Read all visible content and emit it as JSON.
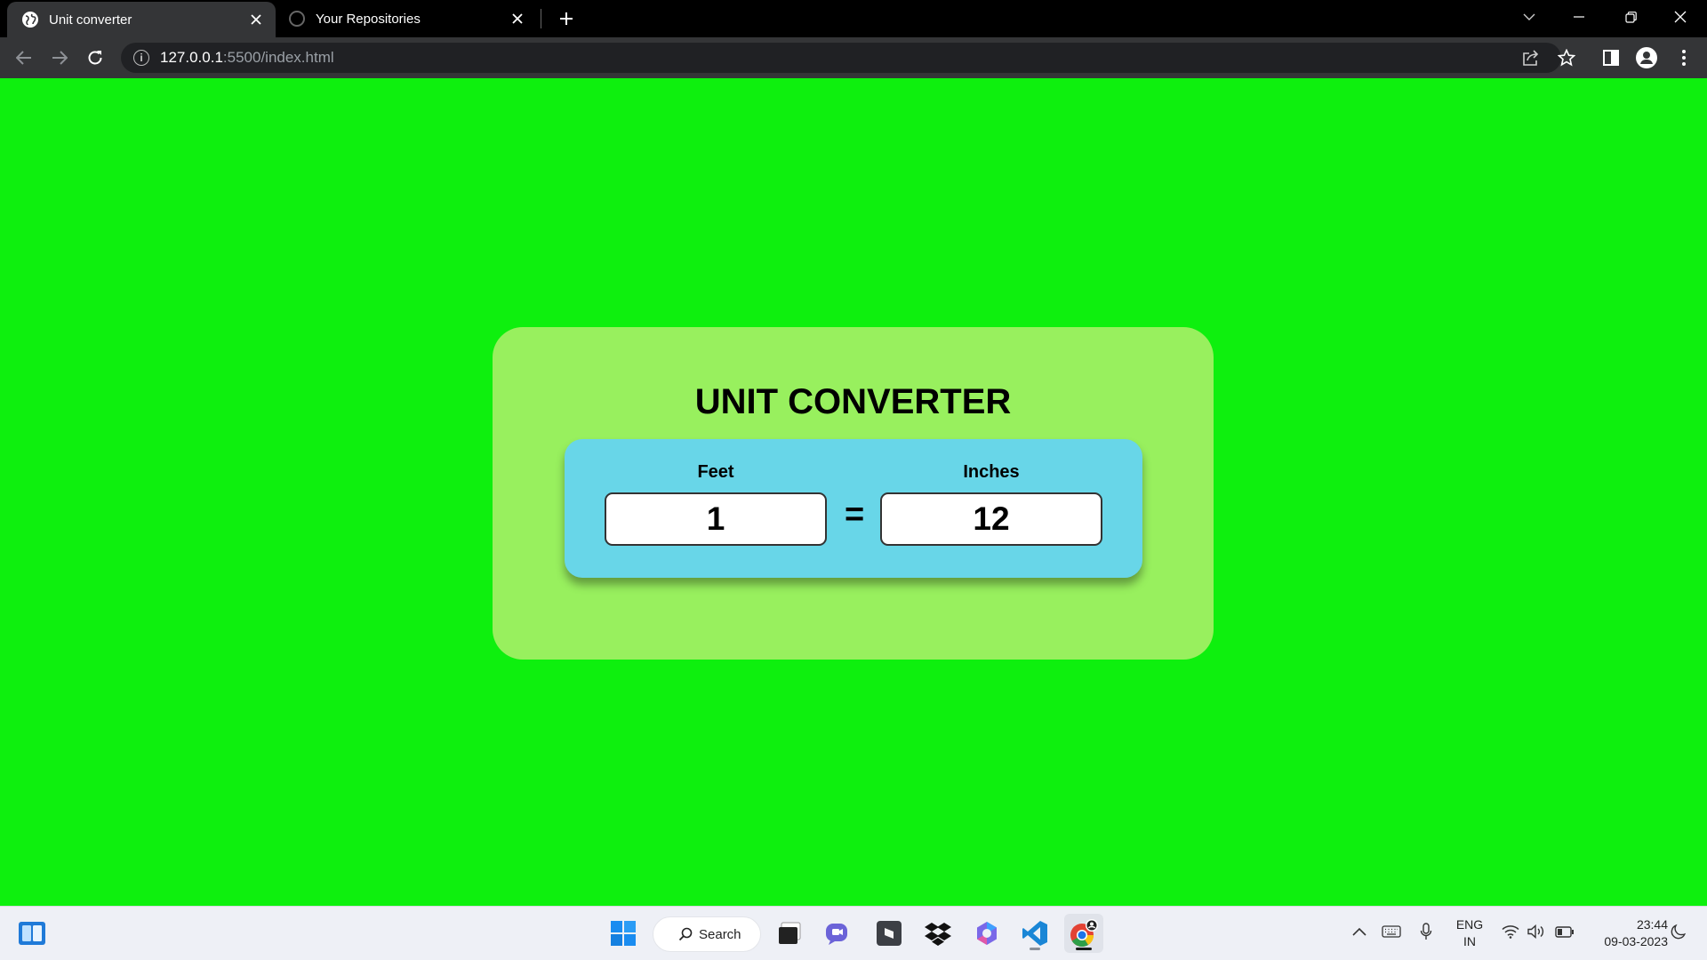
{
  "browser": {
    "tabs": [
      {
        "label": "Unit converter",
        "active": true,
        "favicon": "globe-icon"
      },
      {
        "label": "Your Repositories",
        "active": false,
        "favicon": "github-icon"
      }
    ],
    "url_host": "127.0.0.1",
    "url_rest": ":5500/index.html"
  },
  "page": {
    "background_color": "#0ef00e",
    "card_color": "#98f05e",
    "panel_color": "#68d6e8",
    "title": "UNIT CONVERTER",
    "from_unit_label": "Feet",
    "to_unit_label": "Inches",
    "from_value": "1",
    "to_value": "12",
    "equals_sign": "="
  },
  "taskbar": {
    "search_label": "Search",
    "language_line1": "ENG",
    "language_line2": "IN",
    "time": "23:44",
    "date": "09-03-2023",
    "pinned_apps": [
      "start-icon",
      "task-view-icon",
      "teams-chat-icon",
      "sublime-icon",
      "dropbox-icon",
      "copilot-icon",
      "vscode-icon",
      "chrome-icon"
    ]
  }
}
